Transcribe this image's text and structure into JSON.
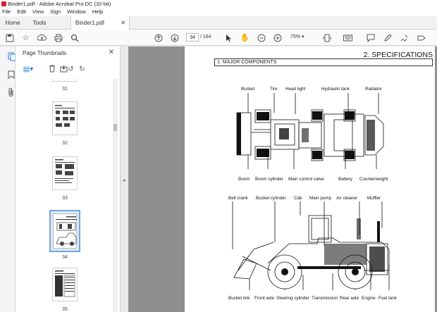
{
  "window": {
    "title": "Binder1.pdf - Adobe Acrobat Pro DC (32-bit)"
  },
  "menu": [
    "File",
    "Edit",
    "View",
    "Sign",
    "Window",
    "Help"
  ],
  "tabs": {
    "home": "Home",
    "tools": "Tools",
    "document": "Binder1.pdf"
  },
  "toolbar": {
    "page_current": "34",
    "page_total": "/ 184",
    "zoom": "75%"
  },
  "panel": {
    "title": "Page Thumbnails"
  },
  "thumbnails": [
    {
      "label": "31"
    },
    {
      "label": "32"
    },
    {
      "label": "33"
    },
    {
      "label": "34",
      "selected": true
    },
    {
      "label": "35"
    }
  ],
  "document": {
    "heading": "2. SPECIFICATIONS",
    "section": "1. MAJOR COMPONENTS",
    "top_labels": {
      "bucket": "Bucket",
      "tire": "Tire",
      "head_light": "Head light",
      "hydraulic_tank": "Hydraulic tank",
      "radiator": "Radiator",
      "boom": "Boom",
      "boom_cylinder": "Boom cylinder",
      "main_control_valve": "Main control valve",
      "battery": "Battery",
      "counterweight": "Counterweight"
    },
    "side_labels": {
      "bell_crank": "Bell crank",
      "bucket_cylinder": "Bucket cylinder",
      "cab": "Cab",
      "main_pump": "Main pump",
      "air_cleaner": "Air cleaner",
      "muffler": "Muffler",
      "bucket_link": "Bucket link",
      "front_axle": "Front axle",
      "steering_cylinder": "Steering cylinder",
      "transmission": "Transmission",
      "rear_axle": "Rear axle",
      "engine": "Engine",
      "fuel_tank": "Fuel tank"
    }
  }
}
